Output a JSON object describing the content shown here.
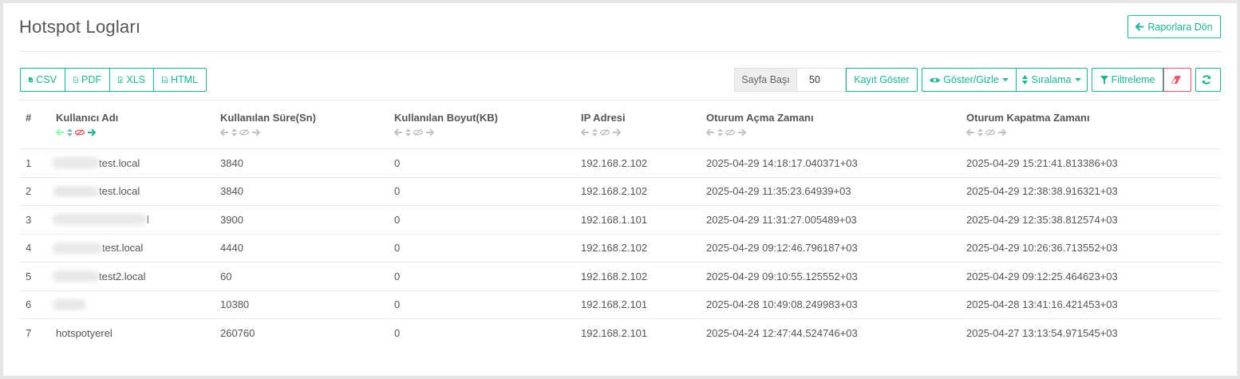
{
  "page": {
    "title": "Hotspot Logları",
    "back_label": "Raporlara Dön"
  },
  "export": {
    "csv": "CSV",
    "pdf": "PDF",
    "xls": "XLS",
    "html": "HTML"
  },
  "toolbar": {
    "per_page_label": "Sayfa Başı",
    "per_page_value": "50",
    "show_records": "Kayıt Göster",
    "show_hide": "Göster/Gizle",
    "sort": "Sıralama",
    "filter": "Filtreleme",
    "colors": {
      "accent": "#1ab394",
      "danger": "#ed5565",
      "active_control": "#ed5565"
    }
  },
  "table": {
    "headers": [
      "#",
      "Kullanıcı Adı",
      "Kullanılan Süre(Sn)",
      "Kullanılan Boyut(KB)",
      "IP Adresi",
      "Oturum Açma Zamanı",
      "Oturum Kapatma Zamanı"
    ],
    "rows": [
      {
        "no": "1",
        "user": "test.local",
        "duration": "3840",
        "size": "0",
        "ip": "192.168.2.102",
        "login": "2025-04-29 14:18:17.040371+03",
        "logout": "2025-04-29 15:21:41.813386+03"
      },
      {
        "no": "2",
        "user": "test.local",
        "duration": "3840",
        "size": "0",
        "ip": "192.168.2.102",
        "login": "2025-04-29 11:35:23.64939+03",
        "logout": "2025-04-29 12:38:38.916321+03"
      },
      {
        "no": "3",
        "user": "l",
        "duration": "3900",
        "size": "0",
        "ip": "192.168.1.101",
        "login": "2025-04-29 11:31:27.005489+03",
        "logout": "2025-04-29 12:35:38.812574+03"
      },
      {
        "no": "4",
        "user": "test.local",
        "duration": "4440",
        "size": "0",
        "ip": "192.168.2.102",
        "login": "2025-04-29 09:12:46.796187+03",
        "logout": "2025-04-29 10:26:36.713552+03"
      },
      {
        "no": "5",
        "user": "test2.local",
        "duration": "60",
        "size": "0",
        "ip": "192.168.2.102",
        "login": "2025-04-29 09:10:55.125552+03",
        "logout": "2025-04-29 09:12:25.464623+03"
      },
      {
        "no": "6",
        "user": "",
        "duration": "10380",
        "size": "0",
        "ip": "192.168.2.101",
        "login": "2025-04-28 10:49:08.249983+03",
        "logout": "2025-04-28 13:41:16.421453+03"
      },
      {
        "no": "7",
        "user": "hotspotyerel",
        "duration": "260760",
        "size": "0",
        "ip": "192.168.2.101",
        "login": "2025-04-24 12:47:44.524746+03",
        "logout": "2025-04-27 13:13:54.971545+03"
      }
    ]
  }
}
